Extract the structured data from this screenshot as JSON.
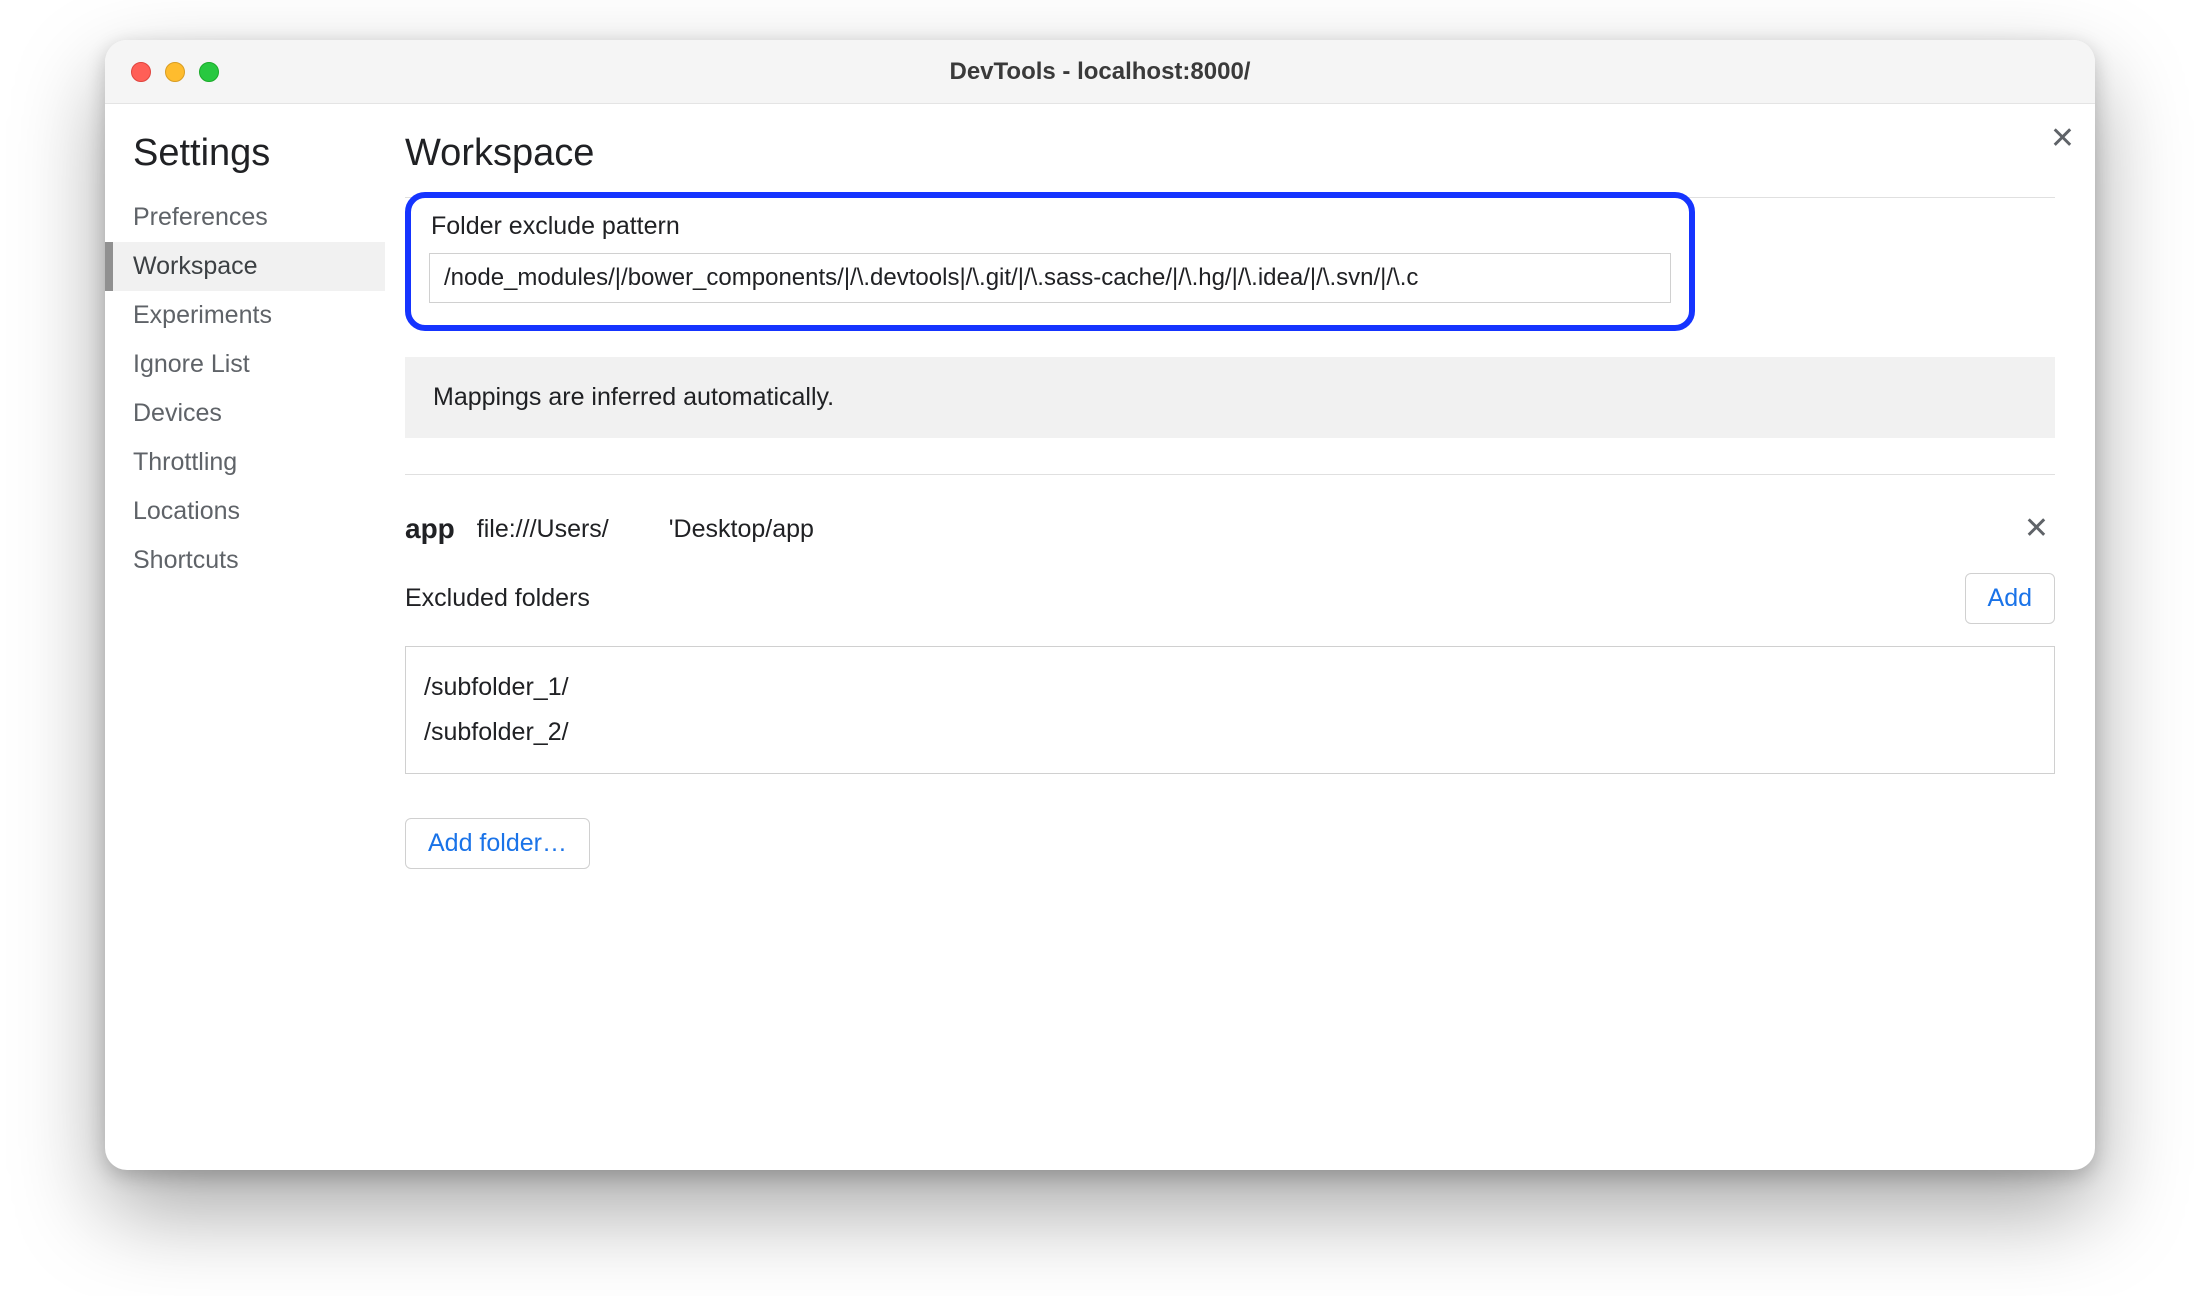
{
  "window": {
    "title": "DevTools - localhost:8000/"
  },
  "sidebar": {
    "heading": "Settings",
    "items": [
      {
        "label": "Preferences",
        "selected": false
      },
      {
        "label": "Workspace",
        "selected": true
      },
      {
        "label": "Experiments",
        "selected": false
      },
      {
        "label": "Ignore List",
        "selected": false
      },
      {
        "label": "Devices",
        "selected": false
      },
      {
        "label": "Throttling",
        "selected": false
      },
      {
        "label": "Locations",
        "selected": false
      },
      {
        "label": "Shortcuts",
        "selected": false
      }
    ]
  },
  "main": {
    "heading": "Workspace",
    "exclude_pattern": {
      "label": "Folder exclude pattern",
      "value": "/node_modules/|/bower_components/|/\\.devtools|/\\.git/|/\\.sass-cache/|/\\.hg/|/\\.idea/|/\\.svn/|/\\.c"
    },
    "info_text": "Mappings are inferred automatically.",
    "folder": {
      "name": "app",
      "url_prefix": "file:///Users/",
      "url_suffix": "'Desktop/app"
    },
    "excluded": {
      "label": "Excluded folders",
      "add_label": "Add",
      "items": [
        "/subfolder_1/",
        "/subfolder_2/"
      ]
    },
    "add_folder_label": "Add folder…"
  }
}
